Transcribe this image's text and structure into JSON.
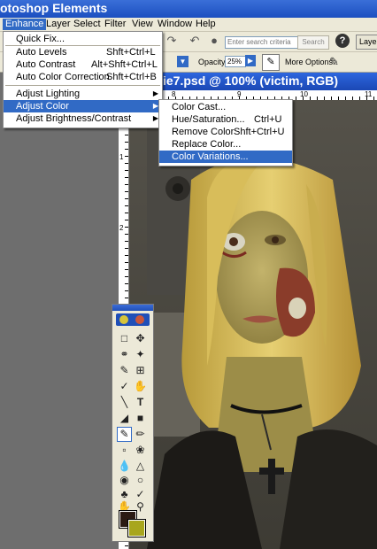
{
  "app": {
    "title": "otoshop Elements"
  },
  "menubar": {
    "items": [
      "Enhance",
      "Layer",
      "Select",
      "Filter",
      "View",
      "Window",
      "Help"
    ],
    "active": "Enhance"
  },
  "shortcuts": {
    "search_placeholder": "Enter search criteria",
    "search_button": "Search",
    "help_label": "?",
    "layers_label": "Layer"
  },
  "options_bar": {
    "opacity_label": "Opacity:",
    "opacity_value": "25%",
    "more_options_label": "More Options:"
  },
  "document": {
    "title": "ie7.psd @ 100% (victim, RGB)",
    "ruler_top": [
      "8",
      "9",
      "10",
      "11"
    ],
    "ruler_left": [
      "1",
      "2"
    ]
  },
  "enhance_menu": {
    "items": [
      {
        "label": "Quick Fix...",
        "shortcut": ""
      },
      {
        "label": "Auto Levels",
        "shortcut": "Shft+Ctrl+L"
      },
      {
        "label": "Auto Contrast",
        "shortcut": "Alt+Shft+Ctrl+L"
      },
      {
        "label": "Auto Color Correction",
        "shortcut": "Shft+Ctrl+B"
      },
      {
        "label": "Adjust Lighting",
        "shortcut": ""
      },
      {
        "label": "Adjust Color",
        "shortcut": ""
      },
      {
        "label": "Adjust Brightness/Contrast",
        "shortcut": ""
      }
    ],
    "highlighted": "Adjust Color"
  },
  "adjust_color_menu": {
    "items": [
      {
        "label": "Color Cast...",
        "shortcut": ""
      },
      {
        "label": "Hue/Saturation...",
        "shortcut": "Ctrl+U"
      },
      {
        "label": "Remove Color",
        "shortcut": "Shft+Ctrl+U"
      },
      {
        "label": "Replace Color...",
        "shortcut": ""
      },
      {
        "label": "Color Variations...",
        "shortcut": ""
      }
    ],
    "highlighted": "Color Variations..."
  },
  "toolbox": {
    "foreground_color": "#2b1a13",
    "background_color": "#a8a61d",
    "tools": [
      "move-tool",
      "marquee-tool",
      "magic-wand-tool",
      "lasso-tool",
      "crop-tool",
      "eyedropper-tool",
      "type-tool",
      "brush-tool",
      "gradient-tool",
      "pencil-tool",
      "eraser-tool",
      "blur-tool",
      "sponge-tool",
      "clone-stamp-tool",
      "hand-tool",
      "zoom-tool"
    ]
  },
  "colors": {
    "accent": "#316ac5",
    "titlebar": "#1c4fc0",
    "chrome": "#ece9d8"
  }
}
